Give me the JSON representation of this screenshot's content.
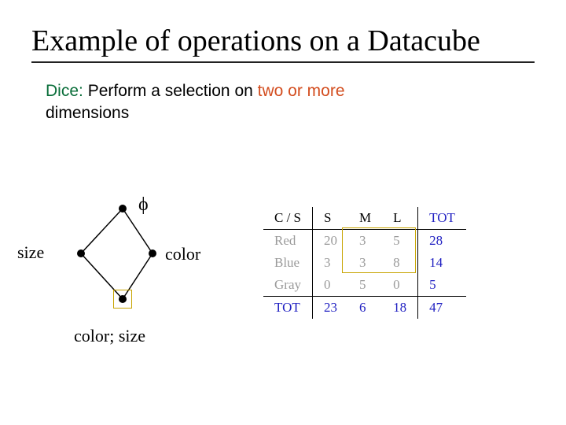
{
  "slide": {
    "title": "Example of operations on a Datacube",
    "body": {
      "dice_label": "Dice:",
      "text_1": " Perform a selection on ",
      "two_or_more": "two or more",
      "text_2": " dimensions"
    }
  },
  "lattice": {
    "top_label": "ϕ",
    "left_label": "size",
    "right_label": "color",
    "bottom_label": "color; size"
  },
  "table": {
    "corner": "C / S",
    "cols": [
      "S",
      "M",
      "L"
    ],
    "tot_label": "TOT",
    "rows": [
      {
        "label": "Red",
        "vals": [
          "20",
          "3",
          "5"
        ],
        "tot": "28"
      },
      {
        "label": "Blue",
        "vals": [
          "3",
          "3",
          "8"
        ],
        "tot": "14"
      },
      {
        "label": "Gray",
        "vals": [
          "0",
          "5",
          "0"
        ],
        "tot": "5"
      }
    ],
    "col_tots": [
      "23",
      "6",
      "18"
    ],
    "grand_tot": "47"
  },
  "chart_data": {
    "type": "table",
    "title": "Color × Size crosstab with totals",
    "row_dimension": "Color",
    "col_dimension": "Size",
    "columns": [
      "S",
      "M",
      "L",
      "TOT"
    ],
    "rows": [
      {
        "label": "Red",
        "values": [
          20,
          3,
          5,
          28
        ]
      },
      {
        "label": "Blue",
        "values": [
          3,
          3,
          8,
          14
        ]
      },
      {
        "label": "Gray",
        "values": [
          0,
          5,
          0,
          5
        ]
      },
      {
        "label": "TOT",
        "values": [
          23,
          6,
          18,
          47
        ]
      }
    ]
  }
}
